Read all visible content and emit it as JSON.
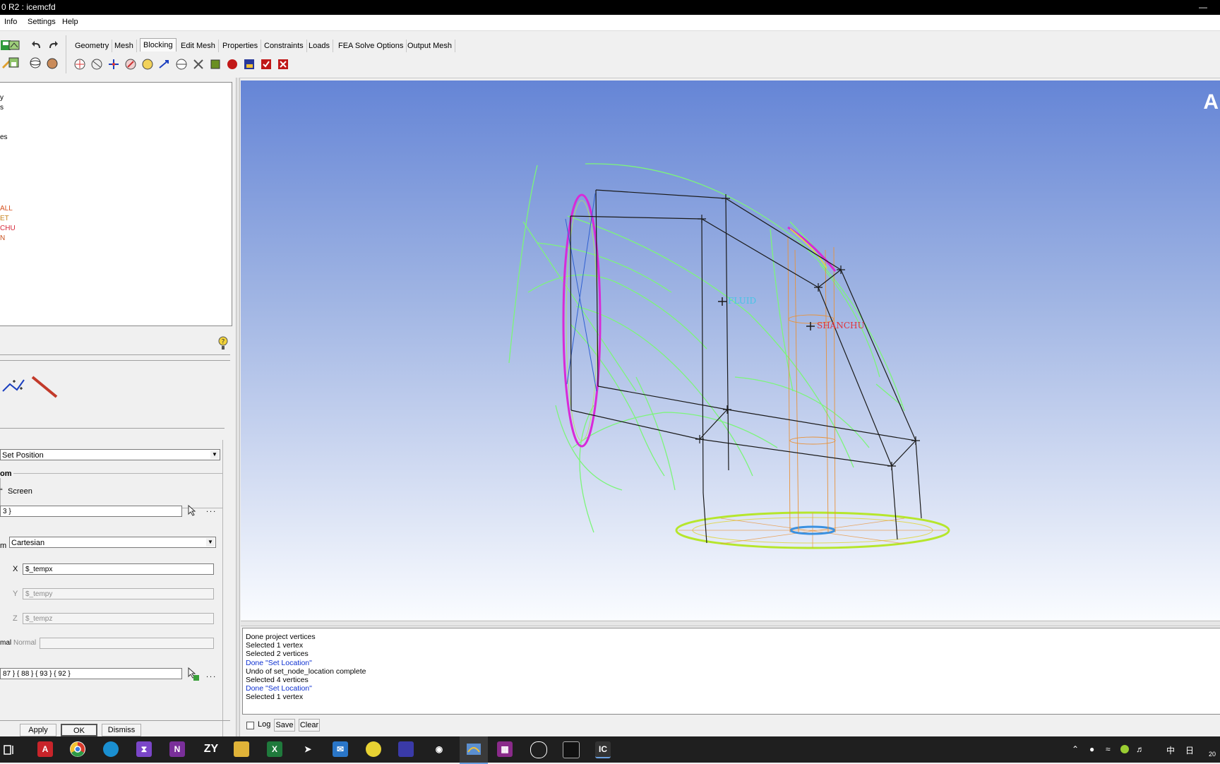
{
  "window": {
    "title": "0 R2 : icemcfd"
  },
  "menu": [
    "Info",
    "Settings",
    "Help"
  ],
  "tabs": [
    "Geometry",
    "Mesh",
    "Blocking",
    "Edit Mesh",
    "Properties",
    "Constraints",
    "Loads",
    "FEA Solve Options",
    "Output Mesh"
  ],
  "active_tab": "Blocking",
  "tree": {
    "items": [
      "y",
      "s",
      "es"
    ],
    "parts": [
      "ALL",
      "ET",
      "CHU",
      "N"
    ]
  },
  "form": {
    "method": "Set Position",
    "group_label": "om",
    "screen_option": "Screen",
    "ref_field": "3 }",
    "coord_label": "m",
    "coord_system": "Cartesian",
    "x_label": "X",
    "x_value": "$_tempx",
    "y_label": "Y",
    "y_value": "$_tempy",
    "z_label": "Z",
    "z_value": "$_tempz",
    "normal_label_cut": "mal",
    "normal_label": "Normal",
    "normal_value": "",
    "vertices_field": "87 } { 88 } { 93 } { 92 }",
    "more": "...",
    "apply": "Apply",
    "ok": "OK",
    "dismiss": "Dismiss"
  },
  "viewport": {
    "corner_label": "A",
    "labels": [
      {
        "text": "FLUID",
        "color": "#46c4e6"
      },
      {
        "text": "SHANCHU",
        "color": "#e0333a"
      }
    ],
    "colors": {
      "wire_green": "#7cf57a",
      "inlet": "#d82ad8",
      "block_edge": "#1a1a1a",
      "outlet": "#b6e62c",
      "hole": "#e8923a"
    }
  },
  "messages": [
    {
      "text": "Done project vertices",
      "style": "normal"
    },
    {
      "text": "Selected 1 vertex",
      "style": "normal"
    },
    {
      "text": "Selected 2 vertices",
      "style": "normal"
    },
    {
      "text": "Done \"Set Location\"",
      "style": "blue"
    },
    {
      "text": "Undo of set_node_location complete",
      "style": "normal"
    },
    {
      "text": "Selected 4 vertices",
      "style": "normal"
    },
    {
      "text": "Done \"Set Location\"",
      "style": "blue"
    },
    {
      "text": "Selected 1 vertex",
      "style": "normal"
    }
  ],
  "msgbar": {
    "log": "Log",
    "save": "Save",
    "clear": "Clear"
  },
  "taskbar": {
    "apps": [
      "A",
      "chrome-icon",
      "edge-icon",
      "vs-icon",
      "N",
      "ZY",
      "folder-icon",
      "X",
      "cursor-icon",
      "mail-icon",
      "ball-icon",
      "chart-icon",
      "wechat-icon",
      "icem-icon",
      "rar-icon",
      "monitor-icon",
      "terminal-icon",
      "IC"
    ],
    "ime": "中",
    "calendar": "日",
    "clock": "20"
  }
}
